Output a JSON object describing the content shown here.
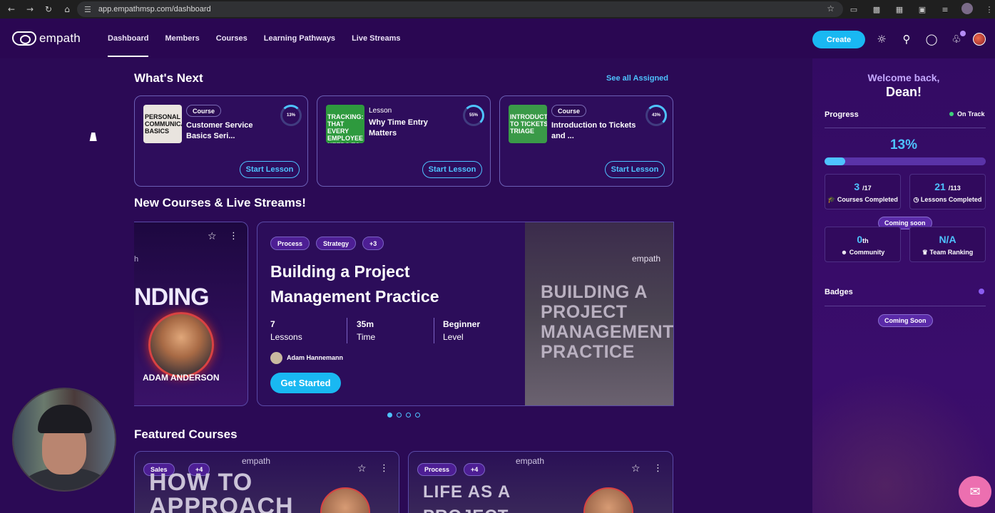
{
  "browser": {
    "url": "app.empathmsp.com/dashboard"
  },
  "app": {
    "logo_text": "empath",
    "nav": [
      {
        "label": "Dashboard",
        "active": true
      },
      {
        "label": "Members",
        "active": false
      },
      {
        "label": "Courses",
        "active": false
      },
      {
        "label": "Learning Pathways",
        "active": false
      },
      {
        "label": "Live Streams",
        "active": false
      }
    ],
    "create_label": "Create",
    "accent_color": "#19b8f2",
    "background_color": "#2b0a55"
  },
  "whats_next": {
    "title": "What's Next",
    "see_all": "See all Assigned",
    "cards": [
      {
        "type": "Course",
        "title": "Customer Service Basics Seri...",
        "progress": "13%",
        "action": "Start Lesson",
        "thumb_text": "PERSONAL COMMUNICATION BASICS"
      },
      {
        "type": "Lesson",
        "title": "Why Time Entry Matters",
        "progress": "55%",
        "action": "Start Lesson",
        "thumb_text": "TRACKING: THAT EVERY EMPLOYEE NEEDS TO KNOW"
      },
      {
        "type": "Course",
        "title": "Introduction to Tickets and ...",
        "progress": "43%",
        "action": "Start Lesson",
        "thumb_text": "INTRODUCTION TO TICKETS & TRIAGE"
      }
    ]
  },
  "new_courses": {
    "title": "New Courses & Live Streams!",
    "prev_slide": {
      "word": "NDING",
      "letter": "h",
      "name": "ADAM ANDERSON"
    },
    "slide": {
      "tags": [
        "Process",
        "Strategy",
        "+3"
      ],
      "title": "Building a Project Management Practice",
      "lessons_value": "7",
      "lessons_label": "Lessons",
      "time_value": "35m",
      "time_label": "Time",
      "level_value": "Beginner",
      "level_label": "Level",
      "author": "Adam Hannemann",
      "cta": "Get Started",
      "art_brand": "empath",
      "art_text": "BUILDING A PROJECT MANAGEMENT PRACTICE"
    },
    "dots": 4,
    "active_dot": 1
  },
  "featured": {
    "title": "Featured Courses",
    "cards": [
      {
        "tags": [
          "Sales",
          "+4"
        ],
        "brand": "empath",
        "art_text": "HOW TO APPROACH"
      },
      {
        "tags": [
          "Process",
          "+4"
        ],
        "brand": "empath",
        "art_text": "LIFE AS A PROJECT"
      }
    ]
  },
  "panel": {
    "welcome": "Welcome back,",
    "name": "Dean!",
    "progress_label": "Progress",
    "status": "On Track",
    "percent": "13%",
    "percent_value": 0.13,
    "courses_done": "3",
    "courses_total": "/17",
    "courses_label": "Courses Completed",
    "lessons_done": "21",
    "lessons_total": "/113",
    "lessons_label": "Lessons Completed",
    "coming_soon": "Coming soon",
    "community_value": "0",
    "community_suffix": "th",
    "community_label": "Community",
    "team_value": "N/A",
    "team_label": "Team Ranking",
    "badges_label": "Badges",
    "badges_soon": "Coming Soon"
  }
}
